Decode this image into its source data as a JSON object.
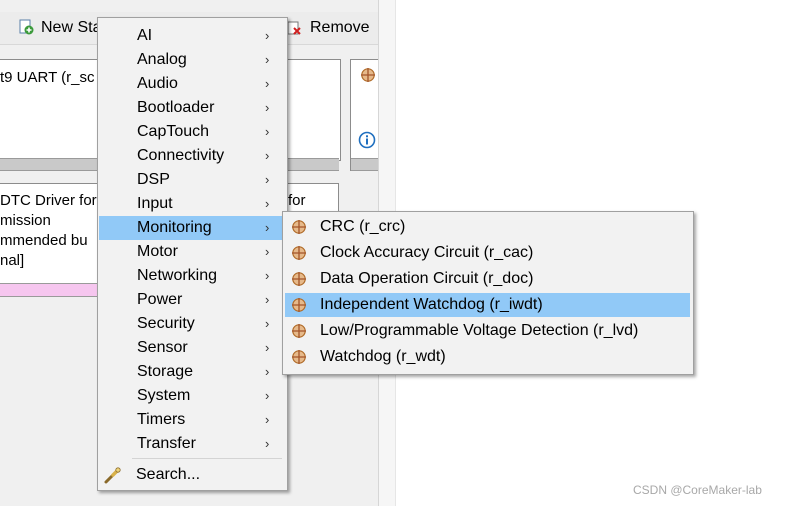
{
  "toolbar": {
    "new_stack_label": "New Sta",
    "remove_label": "Remove"
  },
  "background": {
    "stack1_text": "t9 UART (r_sc",
    "stack2_lines": [
      "DTC Driver for",
      "mission",
      "mmended bu",
      "nal]"
    ],
    "stack2_right_text": "for"
  },
  "context_menu": {
    "items": [
      {
        "label": "AI",
        "has_submenu": true
      },
      {
        "label": "Analog",
        "has_submenu": true
      },
      {
        "label": "Audio",
        "has_submenu": true
      },
      {
        "label": "Bootloader",
        "has_submenu": true
      },
      {
        "label": "CapTouch",
        "has_submenu": true
      },
      {
        "label": "Connectivity",
        "has_submenu": true
      },
      {
        "label": "DSP",
        "has_submenu": true
      },
      {
        "label": "Input",
        "has_submenu": true
      },
      {
        "label": "Monitoring",
        "has_submenu": true,
        "active": true
      },
      {
        "label": "Motor",
        "has_submenu": true
      },
      {
        "label": "Networking",
        "has_submenu": true
      },
      {
        "label": "Power",
        "has_submenu": true
      },
      {
        "label": "Security",
        "has_submenu": true
      },
      {
        "label": "Sensor",
        "has_submenu": true
      },
      {
        "label": "Storage",
        "has_submenu": true
      },
      {
        "label": "System",
        "has_submenu": true
      },
      {
        "label": "Timers",
        "has_submenu": true
      },
      {
        "label": "Transfer",
        "has_submenu": true
      }
    ],
    "search_label": "Search...",
    "chevron": "›"
  },
  "submenu": {
    "items": [
      {
        "label": "CRC (r_crc)"
      },
      {
        "label": "Clock Accuracy Circuit (r_cac)"
      },
      {
        "label": "Data Operation Circuit (r_doc)"
      },
      {
        "label": "Independent Watchdog (r_iwdt)",
        "selected": true
      },
      {
        "label": "Low/Programmable Voltage Detection (r_lvd)"
      },
      {
        "label": "Watchdog (r_wdt)"
      }
    ]
  },
  "watermark": "CSDN @CoreMaker-lab",
  "colors": {
    "highlight": "#91c9f7",
    "menu_bg": "#f2f2f2",
    "pink_bar": "#f6c6ef",
    "component_icon": "#c8732f"
  }
}
